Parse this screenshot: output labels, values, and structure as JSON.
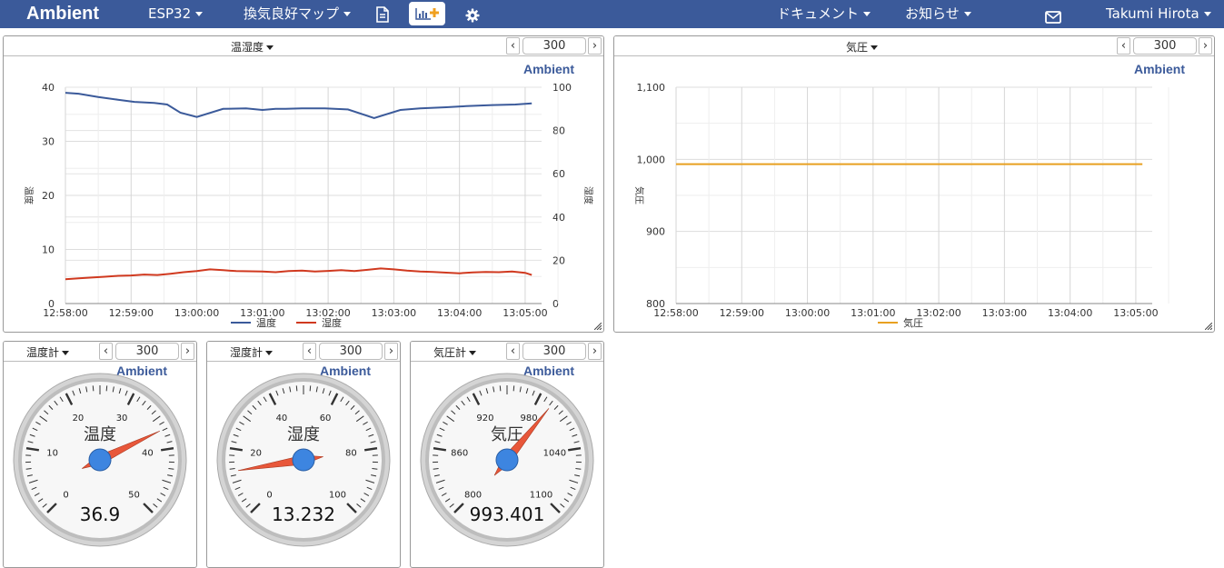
{
  "nav": {
    "brand": "Ambient",
    "device": "ESP32",
    "menu": "換気良好マップ",
    "docs": "ドキュメント",
    "news": "お知らせ",
    "user": "Takumi Hirota",
    "icons": [
      "document-icon",
      "add-chart-icon",
      "gear-icon",
      "mail-icon"
    ]
  },
  "panels": {
    "temp_hum": {
      "title": "温湿度",
      "value": "300",
      "watermark": "Ambient"
    },
    "pressure": {
      "title": "気圧",
      "value": "300",
      "watermark": "Ambient"
    },
    "temp_gauge": {
      "title": "温度計",
      "value": "300",
      "watermark": "Ambient"
    },
    "hum_gauge": {
      "title": "湿度計",
      "value": "300",
      "watermark": "Ambient"
    },
    "pres_gauge": {
      "title": "気圧計",
      "value": "300",
      "watermark": "Ambient"
    }
  },
  "chart_data": [
    {
      "type": "line",
      "x_ticks": [
        "12:58:00",
        "12:59:00",
        "13:00:00",
        "13:01:00",
        "13:02:00",
        "13:03:00",
        "13:04:00",
        "13:05:00"
      ],
      "y_left_label": "温度",
      "y_right_label": "湿度",
      "y_left_ticks": [
        "0",
        "10",
        "20",
        "30",
        "40"
      ],
      "y_right_ticks": [
        "0",
        "20",
        "40",
        "60",
        "80",
        "100"
      ],
      "ylim_left": [
        0,
        40
      ],
      "ylim_right": [
        0,
        100
      ],
      "grid": true,
      "legend_position": "bottom",
      "series": [
        {
          "name": "温度",
          "axis": "left",
          "color": "#3b5a9a",
          "x": [
            -1.0,
            -0.7,
            -0.4,
            -0.15,
            0.2,
            0.5,
            0.8,
            1.05,
            1.35,
            1.55,
            1.75,
            2.0,
            2.4,
            2.75,
            3.0,
            3.2,
            3.35,
            3.6,
            3.95,
            4.3,
            4.7,
            5.1,
            5.4,
            5.8,
            6.1,
            6.5,
            6.85,
            7.1
          ],
          "y": [
            38.0,
            38.4,
            38.7,
            39.1,
            38.8,
            38.2,
            37.7,
            37.3,
            37.1,
            36.8,
            35.3,
            34.5,
            36.0,
            36.1,
            35.8,
            36.0,
            36.0,
            36.1,
            36.1,
            35.9,
            34.3,
            35.8,
            36.1,
            36.3,
            36.5,
            36.7,
            36.8,
            37.0
          ]
        },
        {
          "name": "湿度",
          "axis": "right",
          "color": "#d0391f",
          "x": [
            -1.0,
            -0.8,
            -0.6,
            -0.4,
            -0.2,
            0.0,
            0.2,
            0.4,
            0.6,
            0.8,
            1.0,
            1.2,
            1.4,
            1.6,
            1.8,
            2.0,
            2.2,
            2.4,
            2.6,
            2.8,
            3.0,
            3.2,
            3.4,
            3.6,
            3.8,
            4.0,
            4.2,
            4.4,
            4.6,
            4.8,
            5.0,
            5.2,
            5.4,
            5.6,
            5.8,
            6.0,
            6.2,
            6.4,
            6.6,
            6.8,
            7.0,
            7.1
          ],
          "y": [
            13.2,
            13.5,
            12.8,
            12.2,
            11.6,
            11.2,
            11.7,
            12.0,
            12.4,
            12.8,
            13.0,
            13.4,
            13.2,
            13.8,
            14.5,
            15.0,
            15.8,
            15.4,
            15.0,
            14.9,
            14.8,
            14.5,
            15.0,
            15.2,
            14.8,
            15.1,
            15.4,
            15.0,
            15.6,
            16.2,
            15.8,
            15.2,
            14.8,
            14.6,
            14.3,
            14.0,
            14.4,
            14.6,
            14.5,
            14.8,
            14.2,
            13.2
          ]
        }
      ]
    },
    {
      "type": "line",
      "x_ticks": [
        "12:58:00",
        "12:59:00",
        "13:00:00",
        "13:01:00",
        "13:02:00",
        "13:03:00",
        "13:04:00",
        "13:05:00"
      ],
      "y_left_label": "気圧",
      "y_left_ticks": [
        "800",
        "900",
        "1,000",
        "1,100"
      ],
      "ylim_left": [
        800,
        1100
      ],
      "grid": true,
      "legend_position": "bottom",
      "series": [
        {
          "name": "気圧",
          "axis": "left",
          "color": "#e8a020",
          "x": [
            0,
            7.1
          ],
          "y": [
            993.4,
            993.4
          ]
        }
      ]
    }
  ],
  "gauges": [
    {
      "label": "温度",
      "value": 36.9,
      "display": "36.9",
      "min": 0,
      "max": 50,
      "labels": [
        "0",
        "10",
        "20",
        "30",
        "40",
        "50"
      ]
    },
    {
      "label": "湿度",
      "value": 13.232,
      "display": "13.232",
      "min": 0,
      "max": 100,
      "labels": [
        "0",
        "20",
        "40",
        "60",
        "80",
        "100"
      ]
    },
    {
      "label": "気圧",
      "value": 993.401,
      "display": "993.401",
      "min": 800,
      "max": 1100,
      "labels": [
        "800",
        "860",
        "920",
        "980",
        "1040",
        "1100"
      ]
    }
  ]
}
